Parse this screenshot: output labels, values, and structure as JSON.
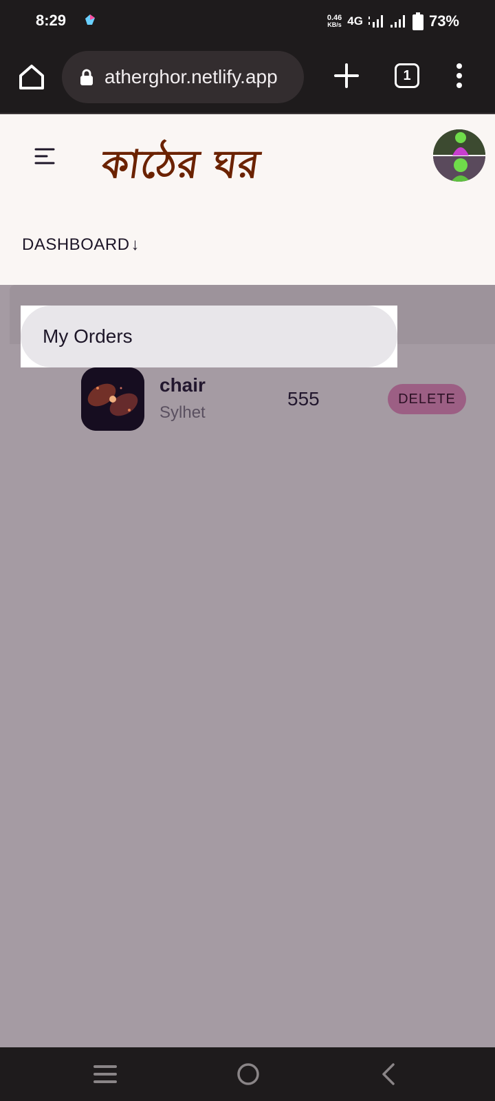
{
  "status_bar": {
    "time": "8:29",
    "net_speed_value": "0.46",
    "net_speed_unit": "KB/s",
    "network_type": "4G",
    "battery_percent": "73%"
  },
  "browser": {
    "url": "atherghor.netlify.app",
    "tab_count": "1"
  },
  "header": {
    "logo_text": "কাঠের ঘর",
    "dashboard_label": "DASHBOARD",
    "dashboard_arrow": "↓"
  },
  "section": {
    "title": "My Orders"
  },
  "orders": [
    {
      "name": "chair",
      "location": "Sylhet",
      "price": "555",
      "delete_label": "DELETE"
    }
  ],
  "colors": {
    "logo": "#6b2200",
    "page_overlay": "#a59ba3",
    "delete_button": "#9c5f84",
    "header_bg": "#faf6f4"
  }
}
